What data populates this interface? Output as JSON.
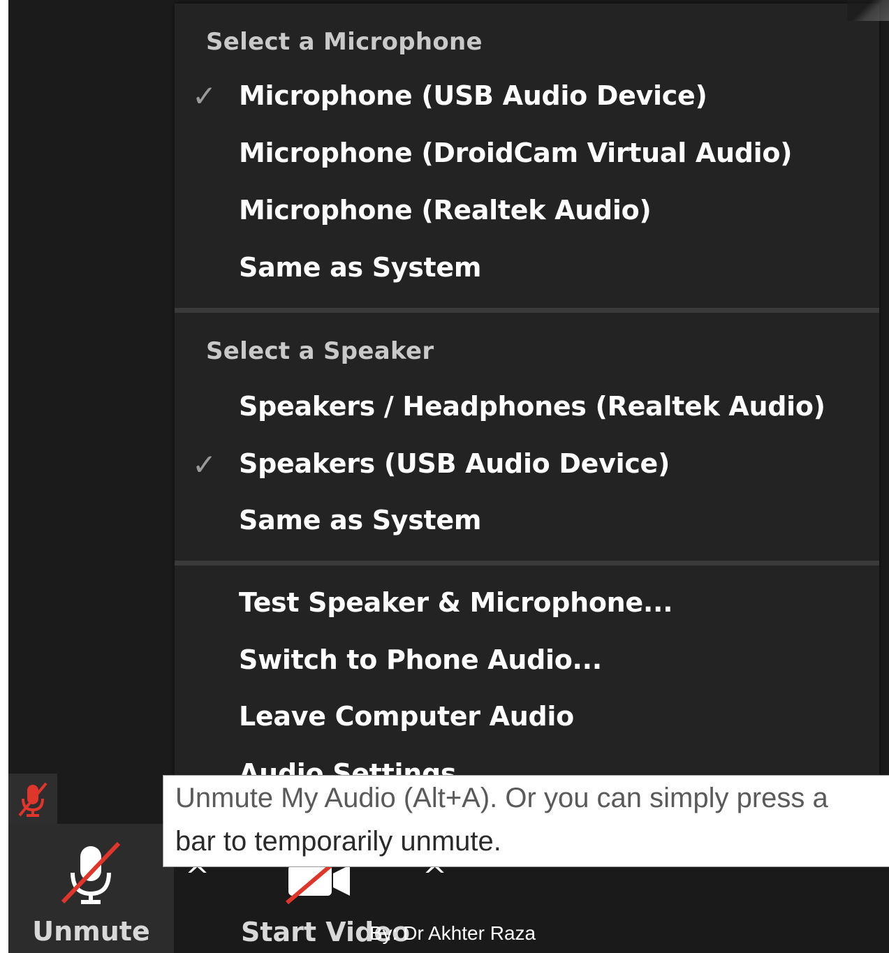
{
  "microphone_section": {
    "header": "Select a Microphone",
    "items": [
      {
        "label": "Microphone (USB Audio Device)",
        "checked": true
      },
      {
        "label": "Microphone (DroidCam Virtual Audio)",
        "checked": false
      },
      {
        "label": "Microphone (Realtek Audio)",
        "checked": false
      },
      {
        "label": "Same as System",
        "checked": false
      }
    ]
  },
  "speaker_section": {
    "header": "Select a Speaker",
    "items": [
      {
        "label": "Speakers / Headphones (Realtek Audio)",
        "checked": false
      },
      {
        "label": "Speakers (USB Audio Device)",
        "checked": true
      },
      {
        "label": "Same as System",
        "checked": false
      }
    ]
  },
  "actions": [
    "Test Speaker & Microphone...",
    "Switch to Phone Audio...",
    "Leave Computer Audio",
    "Audio Settings..."
  ],
  "check_glyph": "✓",
  "tooltip": {
    "line1": "Unmute My Audio (Alt+A). Or you can simply press a",
    "line2": "bar to temporarily unmute."
  },
  "toolbar": {
    "unmute_label": "Unmute",
    "start_video_label": "Start Video",
    "chevron_glyph": "^"
  },
  "credit": "By: Dr Akhter Raza",
  "icons": {
    "status": "muted-mic-icon",
    "unmute": "muted-mic-icon",
    "video": "video-off-icon"
  },
  "colors": {
    "menu_bg": "#232323",
    "muted_red": "#e0352b",
    "header_text": "#c9c9c9",
    "item_text": "#ffffff"
  }
}
